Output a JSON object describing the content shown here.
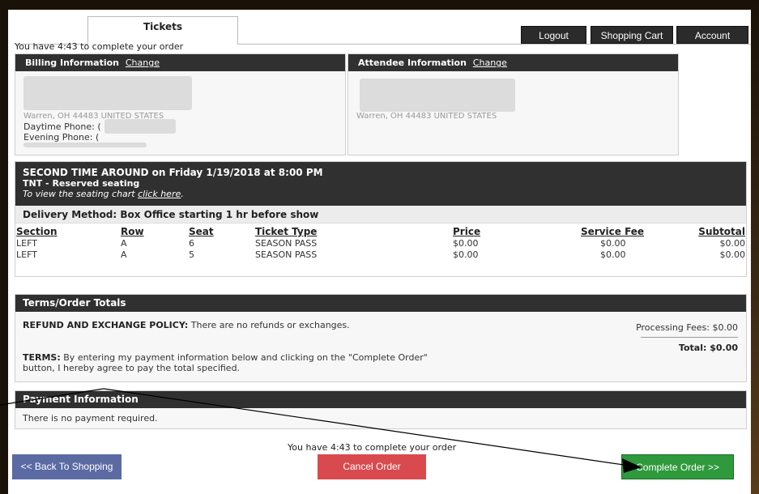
{
  "tabs": {
    "tickets": "Tickets"
  },
  "top_buttons": {
    "logout": "Logout",
    "cart": "Shopping Cart",
    "account": "Account"
  },
  "timer": {
    "top": "You have 4:43 to complete your order",
    "bottom": "You have 4:43 to complete your order"
  },
  "billing": {
    "title": "Billing Information",
    "change": "Change",
    "address_line": "Warren, OH 44483 UNITED STATES",
    "daytime": "Daytime Phone: (",
    "evening": "Evening Phone: ("
  },
  "attendee": {
    "title": "Attendee Information",
    "change": "Change",
    "address_line": "Warren, OH 44483 UNITED STATES"
  },
  "event": {
    "title": "SECOND TIME AROUND on Friday 1/19/2018 at 8:00 PM",
    "venue": "TNT - Reserved seating",
    "seating_prefix": "To view the seating chart ",
    "seating_link": "click here",
    "seating_suffix": ".",
    "delivery": "Delivery Method: Box Office starting 1 hr before show"
  },
  "table": {
    "headers": {
      "section": "Section",
      "row": "Row",
      "seat": "Seat",
      "ticket_type": "Ticket Type",
      "price": "Price",
      "service_fee": "Service Fee",
      "subtotal": "Subtotal"
    },
    "rows": [
      {
        "section": "LEFT",
        "row": "A",
        "seat": "6",
        "ticket_type": "SEASON PASS",
        "price": "$0.00",
        "service_fee": "$0.00",
        "subtotal": "$0.00"
      },
      {
        "section": "LEFT",
        "row": "A",
        "seat": "5",
        "ticket_type": "SEASON PASS",
        "price": "$0.00",
        "service_fee": "$0.00",
        "subtotal": "$0.00"
      }
    ]
  },
  "terms": {
    "title": "Terms/Order Totals",
    "refund_label": "REFUND AND EXCHANGE POLICY:",
    "refund_text": " There are no refunds or exchanges.",
    "terms_label": "TERMS:",
    "terms_text1": " By entering my payment information below and clicking on the \"Complete Order\"",
    "terms_text2": "button, I hereby agree to pay the total specified.",
    "processing": "Processing Fees: $0.00",
    "total": "Total: $0.00"
  },
  "payment": {
    "title": "Payment Information",
    "message": "There is no payment required."
  },
  "buttons": {
    "back": "<< Back To Shopping",
    "cancel": "Cancel Order",
    "complete": "Complete Order >>"
  }
}
